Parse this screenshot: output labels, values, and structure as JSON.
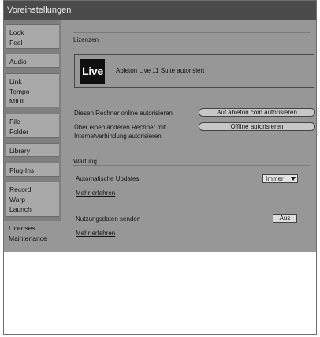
{
  "window": {
    "title": "Voreinstellungen"
  },
  "sidebar": {
    "groups": [
      {
        "items": [
          "Look",
          "Feel"
        ]
      },
      {
        "items": [
          "Audio"
        ]
      },
      {
        "items": [
          "Link",
          "Tempo",
          "MIDI"
        ]
      },
      {
        "items": [
          "File",
          "Folder"
        ]
      },
      {
        "items": [
          "Library"
        ]
      },
      {
        "items": [
          "Plug-Ins"
        ]
      },
      {
        "items": [
          "Record",
          "Warp",
          "Launch"
        ]
      },
      {
        "items": [
          "Licenses",
          "Maintenance"
        ],
        "active": true
      }
    ]
  },
  "licenses": {
    "section_title": "Lizenzen",
    "logo_text": "Live",
    "status_text": "Ableton Live 11 Suite autorisiert",
    "online_label": "Diesen Rechner online autorisieren",
    "online_button": "Auf ableton.com autorisieren",
    "other_label_line1": "Über einen anderen Rechner mit",
    "other_label_line2": "Internetverbindung autorisieren",
    "offline_button": "Offline autorisieren"
  },
  "maintenance": {
    "section_title": "Wartung",
    "updates_label": "Automatische Updates",
    "updates_value": "Immer",
    "more_link_1": "Mehr erfahren",
    "usage_label": "Nutzungsdaten senden",
    "usage_value": "Aus",
    "more_link_2": "Mehr erfahren"
  },
  "colors": {
    "titlebar": "#4b4b4b",
    "panel": "#979797",
    "sidebar_bg": "#7f7f7f",
    "tab": "#a9a9a9",
    "logo_bg": "#0f0f0f"
  },
  "icons": [
    "dropdown-arrow-icon"
  ]
}
